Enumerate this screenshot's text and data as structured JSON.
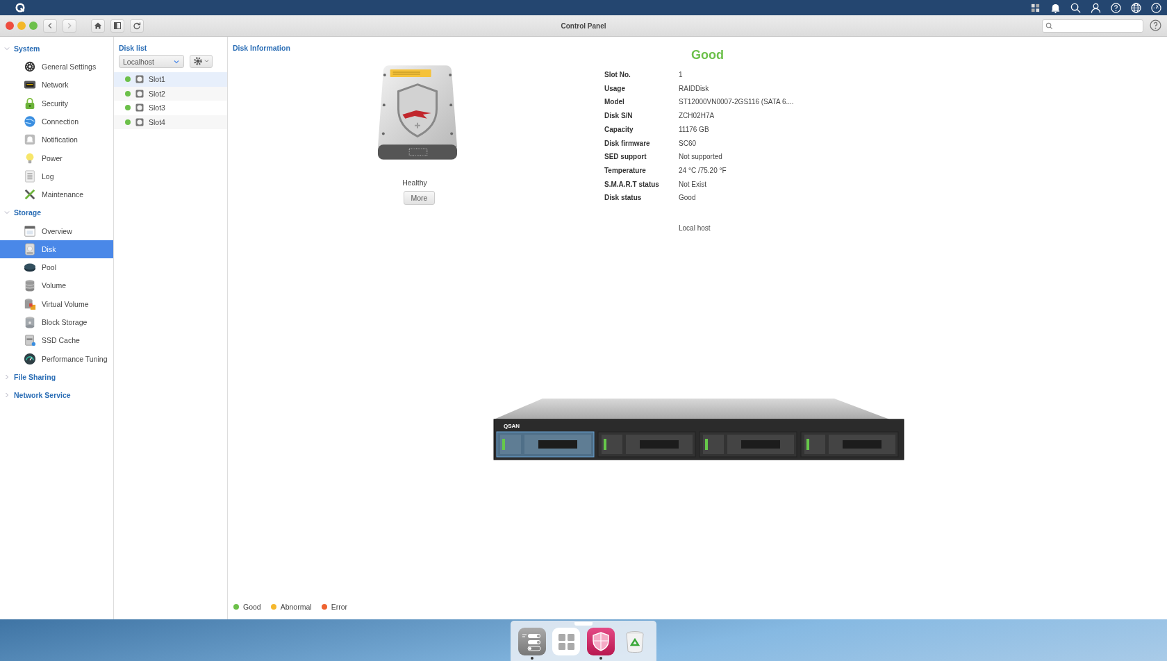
{
  "window": {
    "title": "Control Panel"
  },
  "sidebar": {
    "groups": [
      {
        "label": "System",
        "expanded": true,
        "items": [
          {
            "label": "General Settings",
            "kind": "gear",
            "selected": false
          },
          {
            "label": "Network",
            "kind": "network",
            "selected": false
          },
          {
            "label": "Security",
            "kind": "lock",
            "selected": false
          },
          {
            "label": "Connection",
            "kind": "globe",
            "selected": false
          },
          {
            "label": "Notification",
            "kind": "bell",
            "selected": false
          },
          {
            "label": "Power",
            "kind": "bulb",
            "selected": false
          },
          {
            "label": "Log",
            "kind": "log",
            "selected": false
          },
          {
            "label": "Maintenance",
            "kind": "tools",
            "selected": false
          }
        ]
      },
      {
        "label": "Storage",
        "expanded": true,
        "items": [
          {
            "label": "Overview",
            "kind": "overview",
            "selected": false
          },
          {
            "label": "Disk",
            "kind": "disk",
            "selected": true
          },
          {
            "label": "Pool",
            "kind": "pool",
            "selected": false
          },
          {
            "label": "Volume",
            "kind": "volume",
            "selected": false
          },
          {
            "label": "Virtual Volume",
            "kind": "vvolume",
            "selected": false
          },
          {
            "label": "Block Storage",
            "kind": "block",
            "selected": false
          },
          {
            "label": "SSD Cache",
            "kind": "ssd",
            "selected": false
          },
          {
            "label": "Performance Tuning",
            "kind": "gauge",
            "selected": false
          }
        ]
      },
      {
        "label": "File Sharing",
        "expanded": false
      },
      {
        "label": "Network Service",
        "expanded": false
      }
    ]
  },
  "disk_list": {
    "title": "Disk list",
    "host": "Localhost",
    "slots": [
      {
        "label": "Slot1",
        "color": "#6cc04a",
        "selected": true
      },
      {
        "label": "Slot2",
        "color": "#6cc04a",
        "selected": false
      },
      {
        "label": "Slot3",
        "color": "#6cc04a",
        "selected": false
      },
      {
        "label": "Slot4",
        "color": "#6cc04a",
        "selected": false
      }
    ]
  },
  "disk_info": {
    "title": "Disk Information",
    "health": "Healthy",
    "more_button": "More",
    "status": "Good",
    "fields": [
      {
        "label": "Slot No.",
        "value": "1"
      },
      {
        "label": "Usage",
        "value": "RAIDDisk"
      },
      {
        "label": "Model",
        "value": "ST12000VN0007-2GS116 (SATA 6...."
      },
      {
        "label": "Disk S/N",
        "value": "ZCH02H7A"
      },
      {
        "label": "Capacity",
        "value": "11176 GB"
      },
      {
        "label": "Disk firmware",
        "value": "SC60"
      },
      {
        "label": "SED support",
        "value": "Not supported"
      },
      {
        "label": "Temperature",
        "value": "24 °C /75.20 °F"
      },
      {
        "label": "S.M.A.R.T status",
        "value": "Not Exist"
      },
      {
        "label": "Disk status",
        "value": "Good"
      }
    ],
    "location": "Local host"
  },
  "enclosure": {
    "brand": "QSAN",
    "bays": [
      {
        "selected": true
      },
      {
        "selected": false
      },
      {
        "selected": false
      },
      {
        "selected": false
      }
    ]
  },
  "legend": [
    {
      "label": "Good",
      "color": "#6cc04a"
    },
    {
      "label": "Abnormal",
      "color": "#f5b82e"
    },
    {
      "label": "Error",
      "color": "#ee6331"
    }
  ],
  "dock": [
    {
      "kind": "settings",
      "running": true
    },
    {
      "kind": "apps",
      "running": false
    },
    {
      "kind": "shield",
      "running": true
    },
    {
      "kind": "trash",
      "running": false
    }
  ]
}
